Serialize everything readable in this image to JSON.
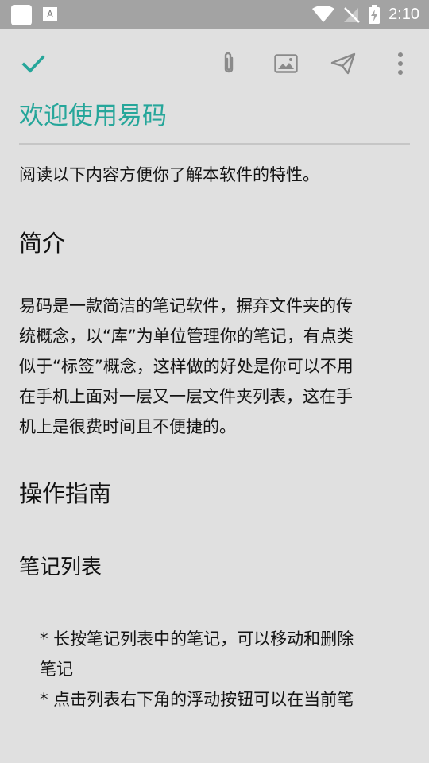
{
  "status_bar": {
    "time": "2:10"
  },
  "toolbar": {
    "icons": [
      "check-icon",
      "paperclip-icon",
      "image-icon",
      "send-icon",
      "more-vert-icon"
    ],
    "accent": "#26a69a"
  },
  "note": {
    "title": "欢迎使用易码",
    "intro": "阅读以下内容方便你了解本软件的特性。",
    "section_intro_heading": "简介",
    "section_intro_lines": [
      "易码是一款简洁的笔记软件，摒弃文件夹的传",
      "统概念，以“库”为单位管理你的笔记，有点类",
      "似于“标签”概念，这样做的好处是你可以不用",
      "在手机上面对一层又一层文件夹列表，这在手",
      "机上是很费时间且不便捷的。"
    ],
    "section_guide_heading": "操作指南",
    "subsection_list_heading": "笔记列表",
    "bullet1_line1": "* 长按笔记列表中的笔记，可以移动和删除",
    "bullet1_line2": "笔记",
    "bullet2_line1": "* 点击列表右下角的浮动按钮可以在当前笔"
  }
}
